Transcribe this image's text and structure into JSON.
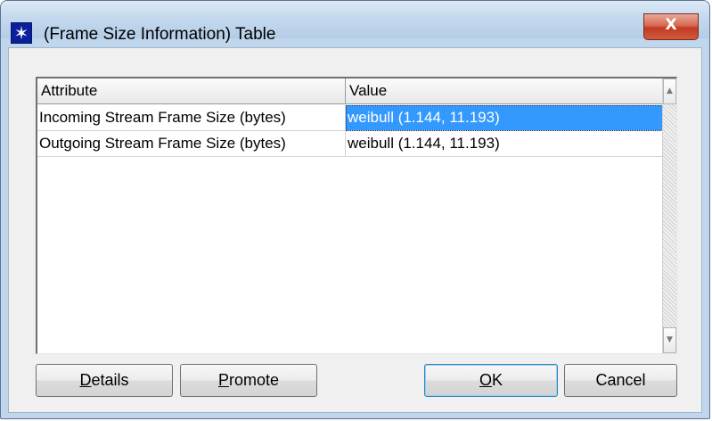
{
  "window": {
    "title": "(Frame Size Information) Table",
    "icon": "asterisk-star-icon",
    "close_icon": "close-x-icon",
    "close_label": "X"
  },
  "table": {
    "columns": [
      "Attribute",
      "Value"
    ],
    "rows": [
      {
        "attribute": "Incoming Stream Frame Size (bytes)",
        "value": "weibull (1.144, 11.193)",
        "selected": true
      },
      {
        "attribute": "Outgoing Stream Frame Size (bytes)",
        "value": "weibull (1.144, 11.193)",
        "selected": false
      }
    ]
  },
  "buttons": {
    "details": {
      "first": "D",
      "rest": "etails"
    },
    "promote": {
      "first": "P",
      "rest": "romote"
    },
    "ok": {
      "first": "O",
      "rest": "K"
    },
    "cancel": {
      "label": "Cancel"
    }
  },
  "colors": {
    "selection": "#3399ff",
    "title_bg": "#bfd6ec",
    "close_button": "#c23b22"
  }
}
